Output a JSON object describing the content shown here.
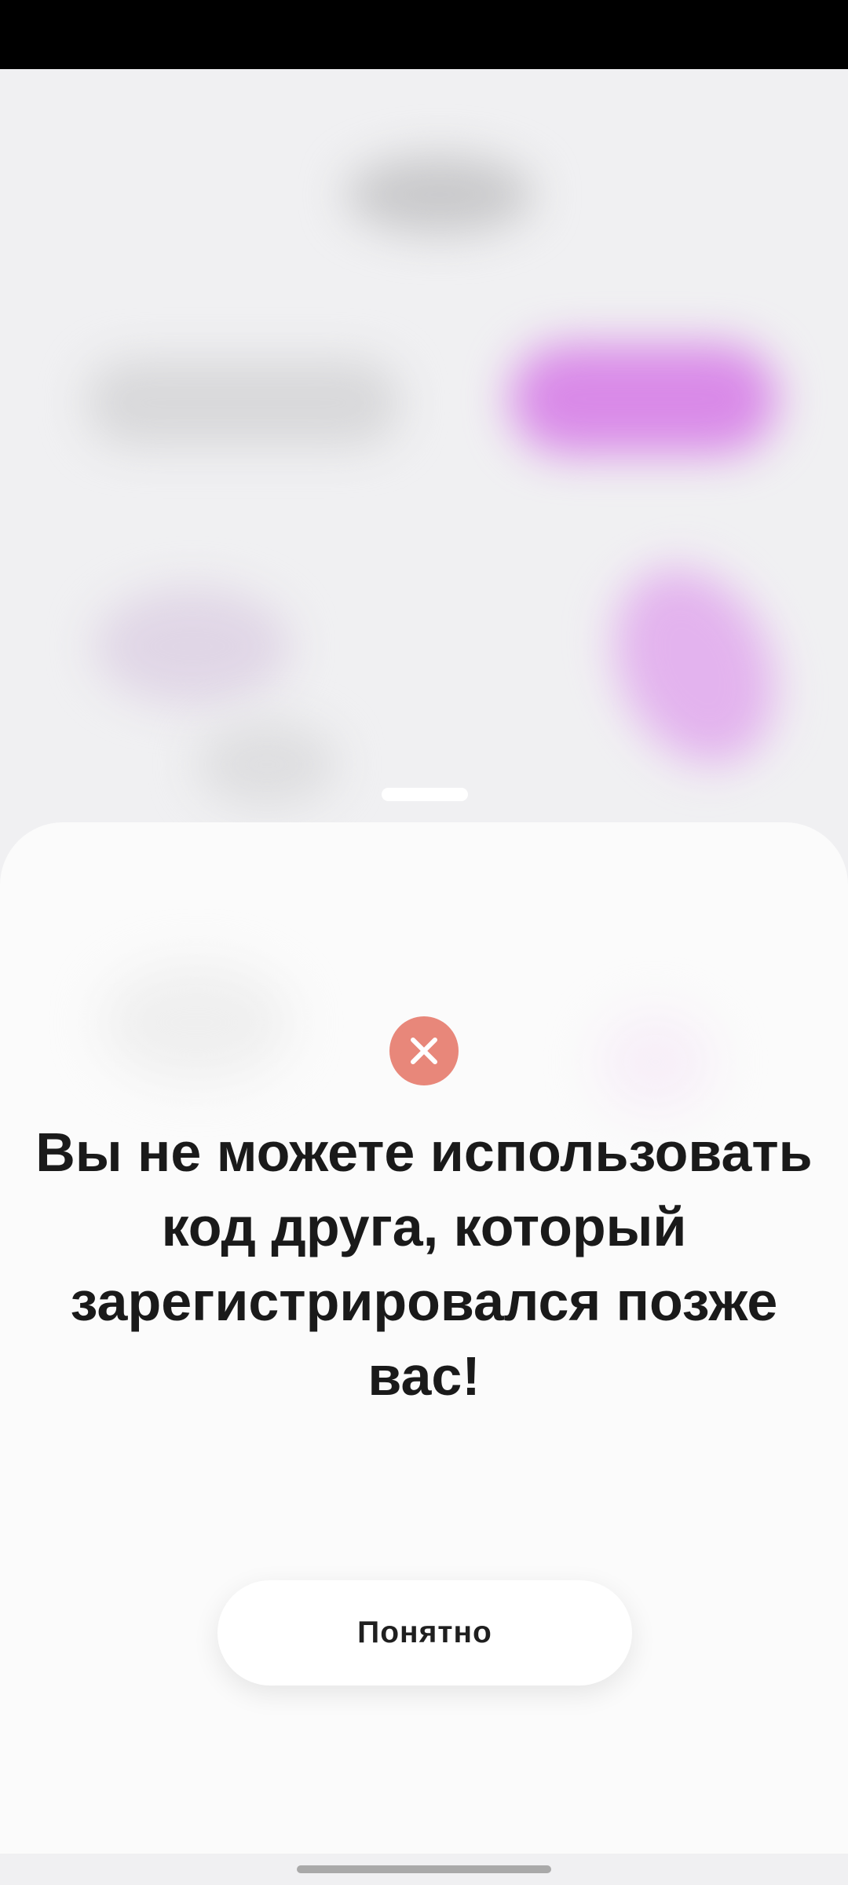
{
  "dialog": {
    "icon": "error-x-icon",
    "icon_color": "#e8877a",
    "message": "Вы не можете использовать код друга, который зарегистрировался позже вас!",
    "ok_label": "Понятно"
  },
  "colors": {
    "status_bar": "#000000",
    "sheet_background": "#fbfbfb",
    "text": "#1a1a1a",
    "accent_blur": "#d98ae8"
  }
}
